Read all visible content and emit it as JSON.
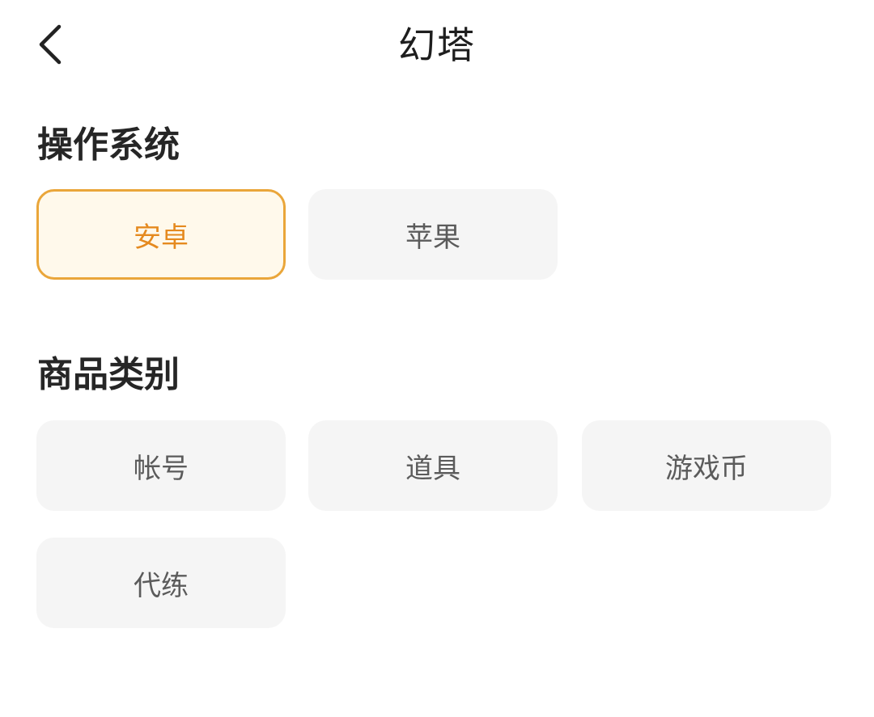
{
  "header": {
    "back_icon": "chevron-left-icon",
    "title": "幻塔"
  },
  "os_section": {
    "title": "操作系统",
    "options": [
      {
        "label": "安卓",
        "selected": true
      },
      {
        "label": "苹果",
        "selected": false
      }
    ]
  },
  "category_section": {
    "title": "商品类别",
    "options": [
      {
        "label": "帐号",
        "selected": false
      },
      {
        "label": "道具",
        "selected": false
      },
      {
        "label": "游戏币",
        "selected": false
      },
      {
        "label": "代练",
        "selected": false
      }
    ]
  },
  "colors": {
    "accent_border": "#eaa63a",
    "accent_text": "#e58a1f",
    "selected_bg": "#fff9eb",
    "chip_bg": "#f5f5f5",
    "chip_text": "#5b5b5b"
  }
}
